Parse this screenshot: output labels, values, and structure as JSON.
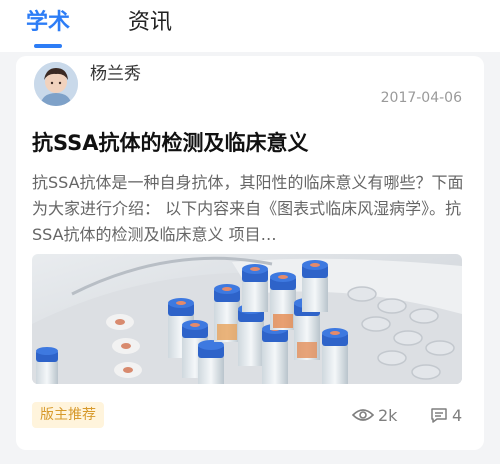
{
  "tabs": [
    {
      "label": "学术",
      "active": true
    },
    {
      "label": "资讯",
      "active": false
    }
  ],
  "post": {
    "author": "杨兰秀",
    "date": "2017-04-06",
    "title": "抗SSA抗体的检测及临床意义",
    "summary": "抗SSA抗体是一种自身抗体，其阳性的临床意义有哪些？下面为大家进行介绍： 以下内容来自《图表式临床风湿病学》。抗SSA抗体的检测及临床意义 项目…",
    "badge": "版主推荐",
    "views": "2k",
    "comments": "4"
  },
  "colors": {
    "accent": "#2d7df6",
    "badge_bg": "#fff4dc",
    "badge_text": "#d79a2c"
  },
  "icons": {
    "views": "eye-icon",
    "comments": "comment-icon"
  }
}
